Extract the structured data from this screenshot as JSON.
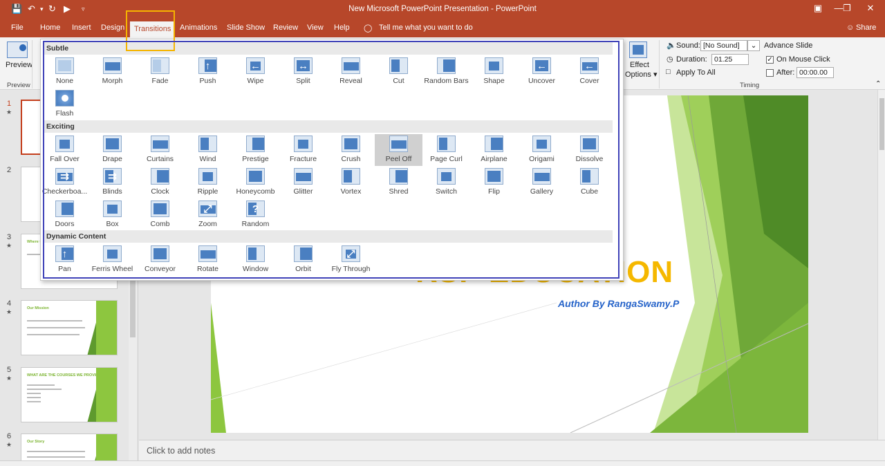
{
  "window": {
    "title": "New Microsoft PowerPoint Presentation  -  PowerPoint"
  },
  "ribbon_tabs": [
    {
      "label": "File"
    },
    {
      "label": "Home"
    },
    {
      "label": "Insert"
    },
    {
      "label": "Design"
    },
    {
      "label": "Transitions",
      "active": true
    },
    {
      "label": "Animations"
    },
    {
      "label": "Slide Show"
    },
    {
      "label": "Review"
    },
    {
      "label": "View"
    },
    {
      "label": "Help"
    }
  ],
  "tell_me": "Tell me what you want to do",
  "share": "Share",
  "ribbon": {
    "preview_label": "Preview",
    "preview_group": "Preview",
    "effect_options": "Effect",
    "effect_options2": "Options ▾",
    "sound_label": "Sound:",
    "sound_value": "[No Sound]",
    "duration_label": "Duration:",
    "duration_value": "01.25",
    "apply_all": "Apply To All",
    "advance_slide": "Advance Slide",
    "on_mouse_click": "On Mouse Click",
    "on_mouse_click_checked": true,
    "after_label": "After:",
    "after_value": "00:00.00",
    "timing_group": "Timing"
  },
  "gallery": {
    "sections": [
      {
        "title": "Subtle",
        "items": [
          "None",
          "Morph",
          "Fade",
          "Push",
          "Wipe",
          "Split",
          "Reveal",
          "Cut",
          "Random Bars",
          "Shape",
          "Uncover",
          "Cover",
          "Flash"
        ]
      },
      {
        "title": "Exciting",
        "items": [
          "Fall Over",
          "Drape",
          "Curtains",
          "Wind",
          "Prestige",
          "Fracture",
          "Crush",
          "Peel Off",
          "Page Curl",
          "Airplane",
          "Origami",
          "Dissolve",
          "Checkerboa...",
          "Blinds",
          "Clock",
          "Ripple",
          "Honeycomb",
          "Glitter",
          "Vortex",
          "Shred",
          "Switch",
          "Flip",
          "Gallery",
          "Cube",
          "Doors",
          "Box",
          "Comb",
          "Zoom",
          "Random"
        ]
      },
      {
        "title": "Dynamic Content",
        "items": [
          "Pan",
          "Ferris Wheel",
          "Conveyor",
          "Rotate",
          "Window",
          "Orbit",
          "Fly Through"
        ]
      }
    ],
    "selected": "Peel Off"
  },
  "slides_pane": {
    "numbers": [
      "1",
      "2",
      "3",
      "4",
      "5",
      "6"
    ],
    "star": "★",
    "thumb_titles": [
      "",
      "",
      "Where t",
      "Our Mission",
      "WHAT ARE THE COURSES WE PROVIDE",
      "Our Story"
    ]
  },
  "slide": {
    "title": "RSP EDUCATION",
    "author": "Author By RangaSwamy.P"
  },
  "notes": {
    "placeholder": "Click to add notes"
  },
  "colors": {
    "accent": "#b7472a",
    "title": "#f5b800",
    "author": "#2563c9",
    "green": "#8dc63f",
    "frame": "#3f42b8",
    "highlight": "#f5b400"
  }
}
